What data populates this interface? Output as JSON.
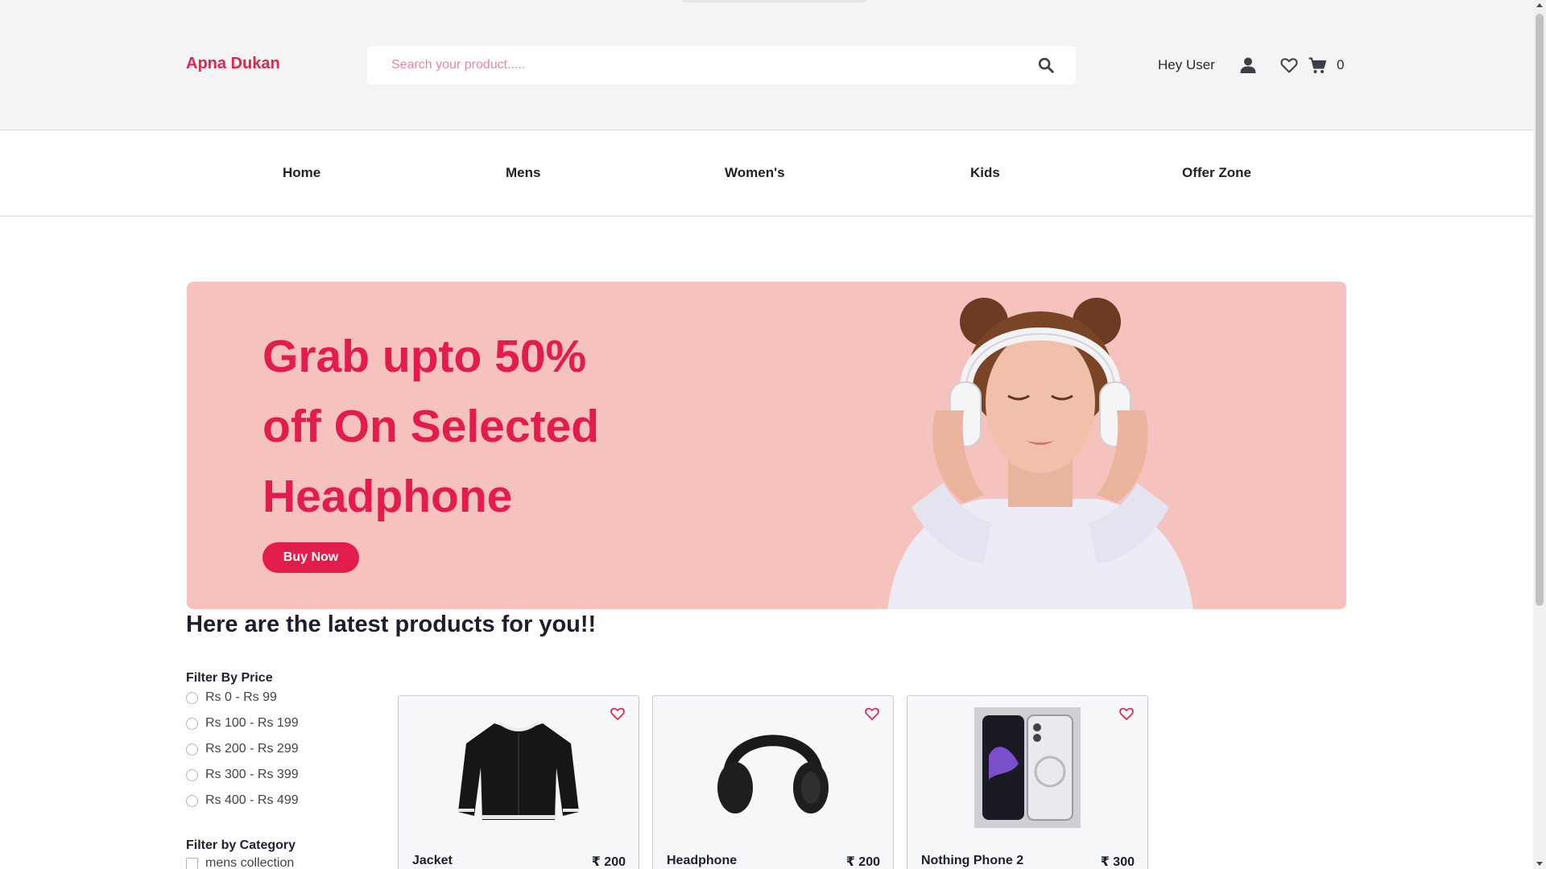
{
  "header": {
    "brand": "Apna Dukan",
    "search_placeholder": "Search your product.....",
    "greeting": "Hey User",
    "cart_count": "0",
    "icons": [
      "search-icon",
      "user-icon",
      "heart-icon",
      "cart-icon"
    ]
  },
  "nav": {
    "items": [
      "Home",
      "Mens",
      "Women's",
      "Kids",
      "Offer Zone"
    ]
  },
  "hero": {
    "line1": "Grab upto 50%",
    "line2": "off On Selected",
    "line3": "Headphone",
    "button": "Buy Now"
  },
  "section_title": "Here are the latest products for you!!",
  "filters": {
    "price_title": "Filter By Price",
    "price_options": [
      "Rs 0 - Rs 99",
      "Rs 100 - Rs 199",
      "Rs 200 - Rs 299",
      "Rs 300 - Rs 399",
      "Rs 400 - Rs 499"
    ],
    "category_title": "Filter by Category",
    "category_options": [
      "mens collection"
    ]
  },
  "products": [
    {
      "name": "Jacket",
      "price": "₹ 200"
    },
    {
      "name": "Headphone",
      "price": "₹ 200"
    },
    {
      "name": "Nothing Phone 2",
      "price": "₹ 300"
    }
  ],
  "colors": {
    "accent": "#e21d4b",
    "hero_bg": "#f6c2bd",
    "header_bg": "#f4f4f4"
  }
}
